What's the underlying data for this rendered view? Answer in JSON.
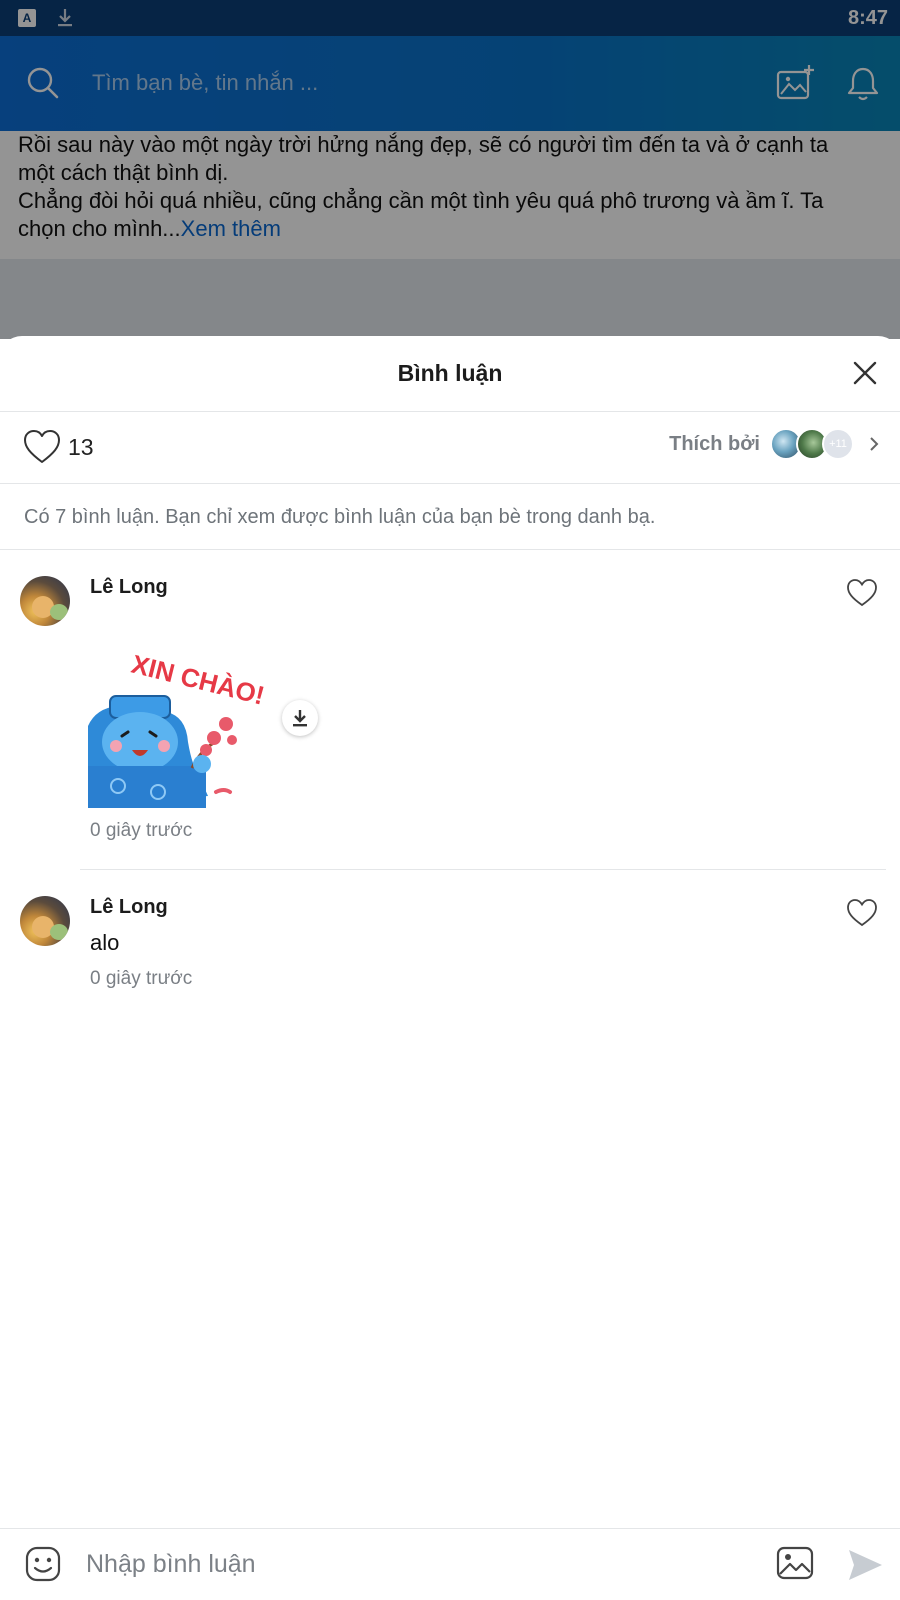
{
  "status_bar": {
    "time": "8:47",
    "left_icons": [
      "a-icon",
      "download-icon"
    ]
  },
  "header": {
    "search_placeholder": "Tìm bạn bè, tin nhắn ...",
    "icons": [
      "search-icon",
      "photo-add-icon",
      "bell-icon"
    ]
  },
  "feed": {
    "line1": "Rồi sau này vào một ngày trời hửng nắng đẹp, sẽ có người tìm đến ta và ở cạnh ta",
    "line2": "một cách thật bình dị.",
    "line3": "Chẳng đòi hỏi quá nhiều, cũng chẳng cần một tình yêu quá phô trương và ầm ĩ. Ta",
    "line4": "chọn cho mình...",
    "see_more": "Xem thêm"
  },
  "sheet": {
    "title": "Bình luận",
    "like_count": "13",
    "liked_by_label": "Thích bởi",
    "liked_by_more": "+11",
    "notice": "Có 7 bình luận. Bạn chỉ xem được bình luận của bạn bè trong danh bạ.",
    "comments": [
      {
        "author": "Lê Long",
        "sticker": "XIN CHÀO!",
        "time": "0 giây trước"
      },
      {
        "author": "Lê Long",
        "text": "alo",
        "time": "0 giây trước"
      }
    ]
  },
  "input": {
    "placeholder": "Nhập bình luận",
    "icons": [
      "emoji-icon",
      "image-icon",
      "send-icon"
    ]
  },
  "colors": {
    "header_blue": "#0d6fd7",
    "link_blue": "#0a68d0",
    "sticker_red": "#e63946",
    "sticker_blue": "#2e8ad8"
  }
}
